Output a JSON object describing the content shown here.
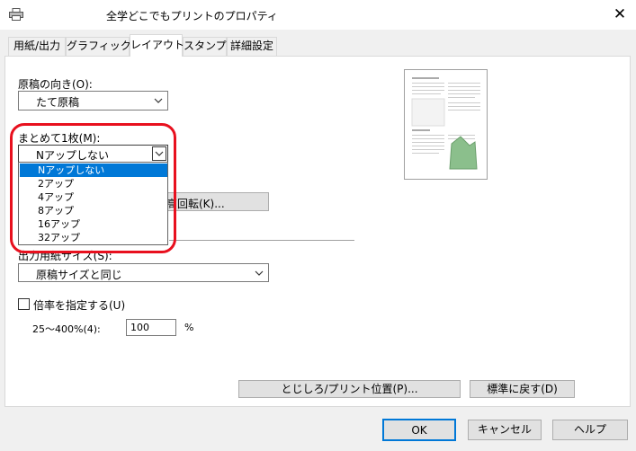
{
  "window": {
    "title": "全学どこでもプリントのプロパティ",
    "close_glyph": "✕"
  },
  "tabs": [
    {
      "label": "用紙/出力",
      "active": false
    },
    {
      "label": "グラフィックス",
      "active": false
    },
    {
      "label": "レイアウト",
      "active": true
    },
    {
      "label": "スタンプ",
      "active": false
    },
    {
      "label": "詳細設定",
      "active": false
    }
  ],
  "layout": {
    "orientation": {
      "label": "原稿の向き(O):",
      "value": "たて原稿"
    },
    "nup": {
      "label": "まとめて1枚(M):",
      "value": "Nアップしない",
      "options": [
        "Nアップしない",
        "2アップ",
        "4アップ",
        "8アップ",
        "16アップ",
        "32アップ"
      ],
      "selected_index": 0
    },
    "rotate_button_partial": "高回転(K)...",
    "output_size": {
      "label_partial": "出力用紙サイズ(S):",
      "value": "原稿サイズと同じ"
    },
    "scale": {
      "checkbox_label": "倍率を指定する(U)",
      "checked": false,
      "range_label": "25～400%(4):",
      "value": "100",
      "unit": "%"
    },
    "margin_button": "とじしろ/プリント位置(P)...",
    "restore_defaults_button": "標準に戻す(D)"
  },
  "footer": {
    "ok": "OK",
    "cancel": "キャンセル",
    "help": "ヘルプ"
  },
  "colors": {
    "selection": "#0078d7",
    "highlight_ring": "#e8101e",
    "panel": "#ffffff",
    "window": "#f0f0f0"
  },
  "icons": [
    "printer-icon",
    "close-icon",
    "chevron-down-icon",
    "page-preview-icon"
  ]
}
